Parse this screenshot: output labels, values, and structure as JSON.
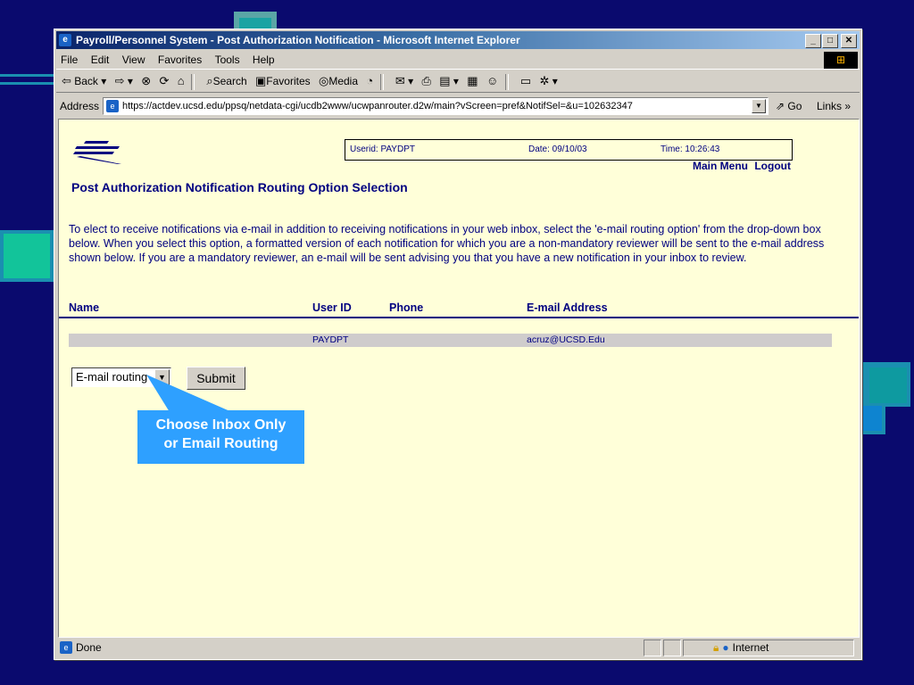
{
  "window": {
    "title": "Payroll/Personnel System - Post Authorization Notification - Microsoft Internet Explorer"
  },
  "menubar": {
    "items": [
      "File",
      "Edit",
      "View",
      "Favorites",
      "Tools",
      "Help"
    ]
  },
  "toolbar": {
    "back": "Back",
    "search": "Search",
    "favorites": "Favorites",
    "media": "Media"
  },
  "addressbar": {
    "label": "Address",
    "url": "https://actdev.ucsd.edu/ppsq/netdata-cgi/ucdb2www/ucwpanrouter.d2w/main?vScreen=pref&NotifSel=&u=102632347",
    "go": "Go",
    "links": "Links"
  },
  "header": {
    "userid": "Userid: PAYDPT",
    "date": "Date: 09/10/03",
    "time": "Time: 10:26:43",
    "main_menu": "Main Menu",
    "logout": "Logout"
  },
  "page": {
    "title": "Post Authorization Notification Routing Option Selection",
    "intro": "To elect to receive notifications via e-mail in addition to receiving notifications in your web inbox, select the 'e-mail routing option' from the drop-down box below. When you select this option, a formatted version of each notification for which you are a non-mandatory reviewer will be sent to the e-mail address shown below. If you are a mandatory reviewer, an e-mail will be sent advising you that you have a new notification in your inbox to review."
  },
  "table": {
    "headers": [
      "Name",
      "User ID",
      "Phone",
      "E-mail Address"
    ],
    "rows": [
      {
        "name": "",
        "user_id": "PAYDPT",
        "phone": "",
        "email": "acruz@UCSD.Edu"
      }
    ]
  },
  "form": {
    "routing_value": "E-mail routing",
    "submit_label": "Submit"
  },
  "callout": {
    "line1": "Choose Inbox Only",
    "line2": "or Email Routing"
  },
  "statusbar": {
    "status": "Done",
    "zone": "Internet"
  },
  "colors": {
    "slide_background": "#0a0a6e",
    "page_background": "#ffffd9",
    "text_navy": "#000080",
    "callout": "#2ea0ff"
  }
}
